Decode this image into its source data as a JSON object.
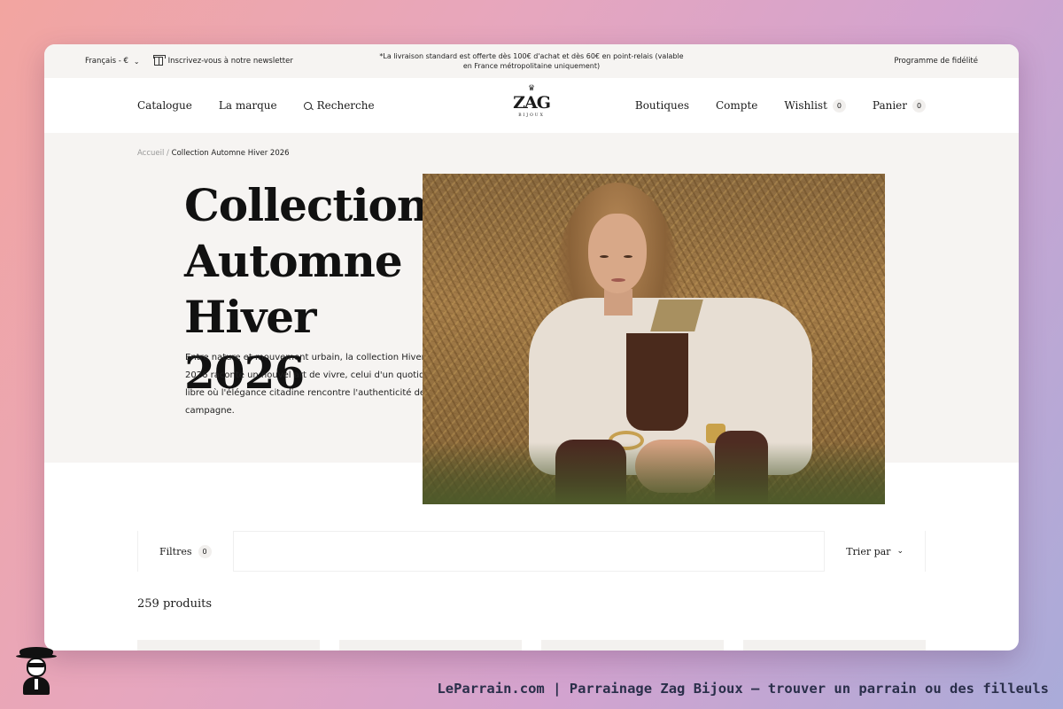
{
  "topbar": {
    "language": "Français - €",
    "newsletter": "Inscrivez-vous à notre newsletter",
    "promo": "*La livraison standard est offerte dès 100€ d'achat et dès 60€ en point-relais (valable en France métropolitaine uniquement)",
    "loyalty": "Programme de fidélité"
  },
  "nav": {
    "catalogue": "Catalogue",
    "brand": "La marque",
    "search": "Recherche",
    "stores": "Boutiques",
    "account": "Compte",
    "wishlist": "Wishlist",
    "wishlist_count": "0",
    "cart": "Panier",
    "cart_count": "0"
  },
  "logo": {
    "crown": "♛",
    "name": "ZAG",
    "tagline": "BIJOUX"
  },
  "breadcrumb": {
    "home": "Accueil",
    "separator": " / ",
    "current": "Collection Automne Hiver 2026"
  },
  "hero": {
    "title": "Collection Automne Hiver 2026",
    "description": "Entre nature et mouvement urbain, la collection Hiver 2026 raconte un nouvel art de vivre, celui d'un quotidien libre où l'élégance citadine rencontre l'authenticité de la campagne."
  },
  "toolbar": {
    "filters": "Filtres",
    "filters_count": "0",
    "sort": "Trier par"
  },
  "listing": {
    "product_count": "259 produits"
  },
  "footer": {
    "caption": "LeParrain.com | Parrainage Zag Bijoux — trouver un parrain ou des filleuls"
  }
}
